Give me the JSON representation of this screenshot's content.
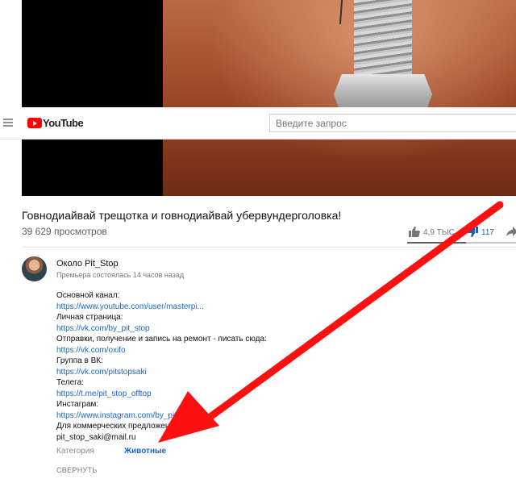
{
  "header": {
    "logo_text": "YouTube",
    "search_placeholder": "Введите запрос"
  },
  "video": {
    "title": "Говнодиайвай трещотка и говнодиайвай убервундерголовка!",
    "views": "39 629 просмотров",
    "likes": "4,9 ТЫС.",
    "dislikes": "117",
    "like_ratio_percent": 54
  },
  "channel": {
    "name": "Около Pit_Stop",
    "premiere_text": "Премьера состоялась 14 часов назад"
  },
  "description": {
    "lines": [
      {
        "text": "Основной канал:",
        "is_link": false
      },
      {
        "text": "https://www.youtube.com/user/masterpi...",
        "is_link": true
      },
      {
        "text": "Личная страница:",
        "is_link": false
      },
      {
        "text": "https://vk.com/by_pit_stop",
        "is_link": true
      },
      {
        "text": "Отправки, получение и запись на ремонт - писать сюда:",
        "is_link": false
      },
      {
        "text": "https://vk.com/oxifo",
        "is_link": true
      },
      {
        "text": "Группа в ВК:",
        "is_link": false
      },
      {
        "text": "https://vk.com/pitstopsaki",
        "is_link": true
      },
      {
        "text": "Телега:",
        "is_link": false
      },
      {
        "text": "https://t.me/pit_stop_offtop",
        "is_link": true
      },
      {
        "text": "Инстаграм:",
        "is_link": false
      },
      {
        "text": "https://www.instagram.com/by_pit_stop/",
        "is_link": true
      },
      {
        "text": "Для коммерческих предложений:",
        "is_link": false
      },
      {
        "text": "pit_stop_saki@mail.ru",
        "is_link": false
      }
    ],
    "category_label": "Категория",
    "category_value": "Животные",
    "collapse_label": "СВЕРНУТЬ"
  },
  "colors": {
    "brand_red": "#ff0000",
    "link_blue": "#1a66c2",
    "annotation_arrow": "#ff0000"
  },
  "icons": {
    "menu": "hamburger-icon",
    "like": "thumb-up-icon",
    "dislike": "thumb-down-icon",
    "share": "share-arrow-icon"
  }
}
